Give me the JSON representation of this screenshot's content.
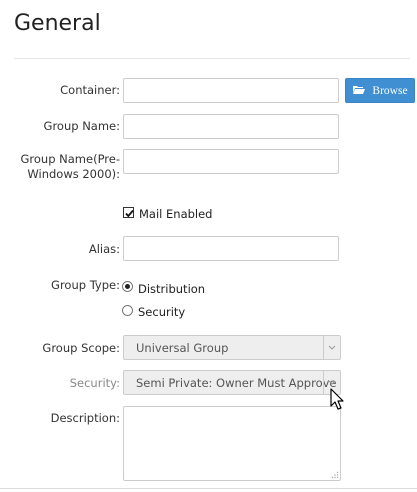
{
  "page": {
    "title": "General"
  },
  "form": {
    "container": {
      "label": "Container:",
      "value": "",
      "placeholder": ""
    },
    "browse_button": {
      "label": "Browse",
      "icon": "folder-open-icon"
    },
    "group_name": {
      "label": "Group Name:",
      "value": ""
    },
    "group_name_pre2000": {
      "label_line1": "Group Name(Pre-",
      "label_line2": "Windows 2000):",
      "value": ""
    },
    "mail_enabled": {
      "label": "Mail Enabled",
      "checked": true
    },
    "alias": {
      "label": "Alias:",
      "value": ""
    },
    "group_type": {
      "label": "Group Type:",
      "options": [
        {
          "label": "Distribution",
          "selected": true
        },
        {
          "label": "Security",
          "selected": false
        }
      ]
    },
    "group_scope": {
      "label": "Group Scope:",
      "value": "Universal Group",
      "disabled": true
    },
    "security": {
      "label": "Security:",
      "value": "Semi Private: Owner Must Approve",
      "disabled": true
    },
    "description": {
      "label": "Description:",
      "value": ""
    }
  },
  "colors": {
    "accent": "#3f8fd2",
    "disabled_bg": "#eeeeee",
    "border": "#cccccc"
  }
}
